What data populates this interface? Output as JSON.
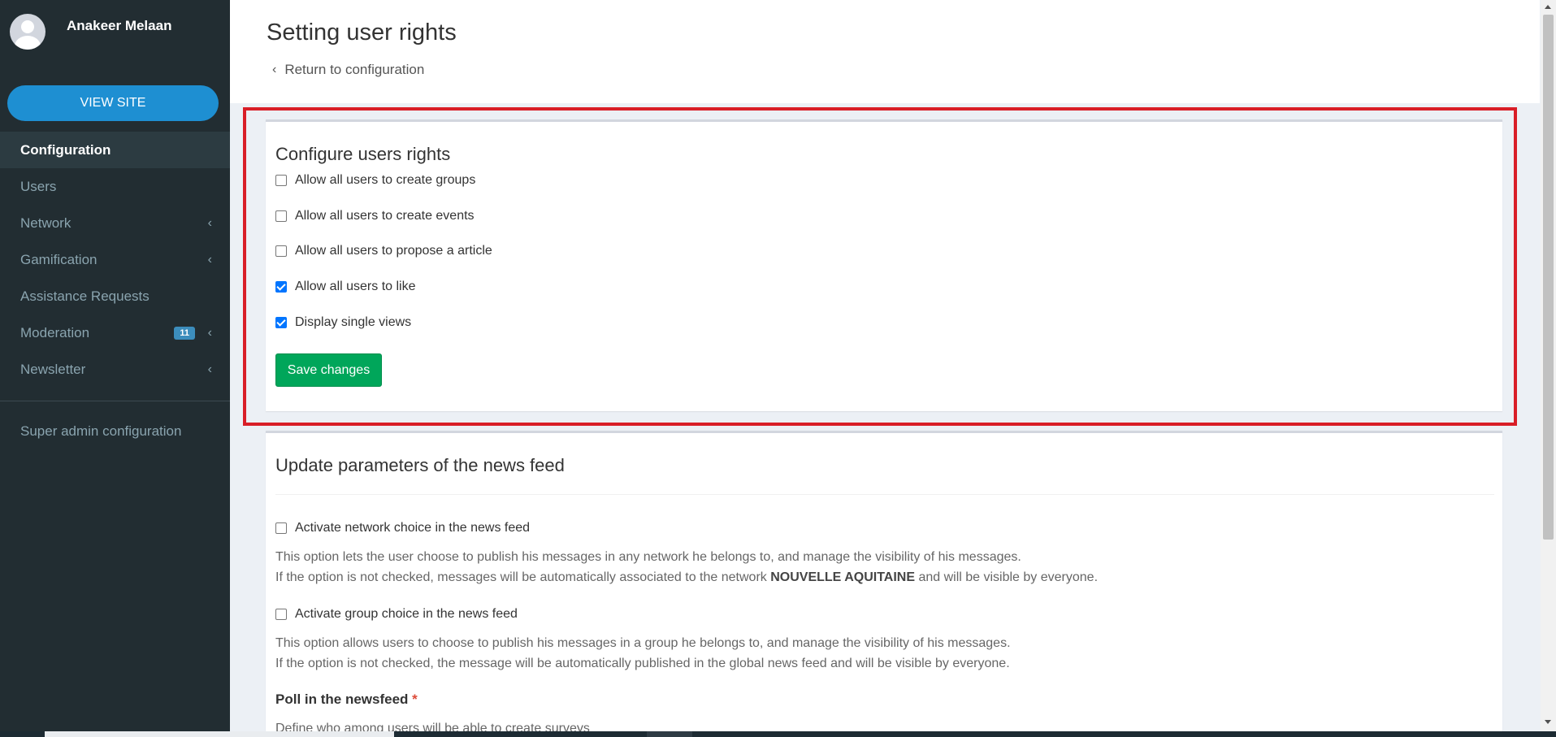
{
  "user": {
    "name": "Anakeer Melaan"
  },
  "sidebar": {
    "view_site": "VIEW SITE",
    "items": [
      {
        "label": "Configuration",
        "active": true,
        "has_chevron": false
      },
      {
        "label": "Users",
        "active": false,
        "has_chevron": false
      },
      {
        "label": "Network",
        "active": false,
        "has_chevron": true
      },
      {
        "label": "Gamification",
        "active": false,
        "has_chevron": true
      },
      {
        "label": "Assistance Requests",
        "active": false,
        "has_chevron": false
      },
      {
        "label": "Moderation",
        "active": false,
        "has_chevron": true,
        "badge": "11"
      },
      {
        "label": "Newsletter",
        "active": false,
        "has_chevron": true
      }
    ],
    "super_admin": "Super admin configuration"
  },
  "header": {
    "title": "Setting user rights",
    "back_label": "Return to configuration"
  },
  "rights": {
    "title": "Configure users rights",
    "options": [
      {
        "label": "Allow all users to create groups",
        "checked": false
      },
      {
        "label": "Allow all users to create events",
        "checked": false
      },
      {
        "label": "Allow all users to propose a article",
        "checked": false
      },
      {
        "label": "Allow all users to like",
        "checked": true
      },
      {
        "label": "Display single views",
        "checked": true
      }
    ],
    "save_label": "Save changes"
  },
  "newsfeed": {
    "title": "Update parameters of the news feed",
    "network_choice_label": "Activate network choice in the news feed",
    "network_help_1": "This option lets the user choose to publish his messages in any network he belongs to, and manage the visibility of his messages.",
    "network_help_2a": "If the option is not checked, messages will be automatically associated to the network ",
    "network_help_2b": "NOUVELLE AQUITAINE",
    "network_help_2c": " and will be visible by everyone.",
    "group_choice_label": "Activate group choice in the news feed",
    "group_help_1": "This option allows users to choose to publish his messages in a group he belongs to, and manage the visibility of his messages.",
    "group_help_2": "If the option is not checked, the message will be automatically published in the global news feed and will be visible by everyone.",
    "poll_label": "Poll in the newsfeed",
    "poll_required": "*",
    "poll_help": "Define who among users will be able to create surveys"
  },
  "colors": {
    "sidebar_bg": "#222d32",
    "accent_blue": "#1e8fd2",
    "save_green": "#00a65a",
    "highlight_red": "#d91e27"
  }
}
